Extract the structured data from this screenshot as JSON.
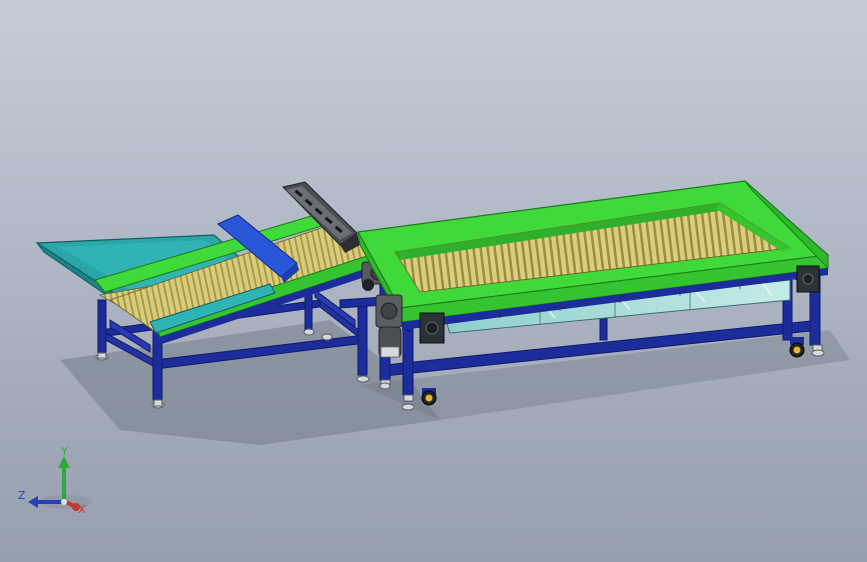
{
  "colors": {
    "background_top": "#c5ccd7",
    "background_bottom": "#969fae",
    "frame_blue": "#1c2c9a",
    "frame_blue_dark": "#0e1a6a",
    "conveyor_green": "#3fd93a",
    "conveyor_green_dark": "#1f9b1c",
    "hopper_teal": "#2aa6a8",
    "roller_yellow": "#cdbf67",
    "blue_panel": "#2a56d8",
    "gray_motor": "#55585d",
    "glass": "#a9dcd8",
    "axis_x": "#c0392b",
    "axis_y": "#2faa3a",
    "axis_z": "#2a3fb5"
  },
  "triad": {
    "x_label": "X",
    "y_label": "Y",
    "z_label": "Z"
  }
}
